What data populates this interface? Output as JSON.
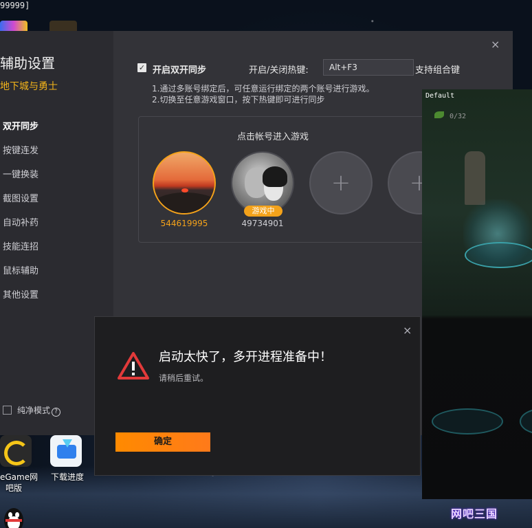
{
  "screen_caption": "99999]",
  "settings": {
    "title": "辅助设置",
    "subtitle": "地下城与勇士",
    "close": "×",
    "nav": [
      {
        "label": "双开同步",
        "active": true
      },
      {
        "label": "按键连发"
      },
      {
        "label": "一键换装"
      },
      {
        "label": "截图设置"
      },
      {
        "label": "自动补药"
      },
      {
        "label": "技能连招"
      },
      {
        "label": "鼠标辅助"
      },
      {
        "label": "其他设置"
      }
    ],
    "pure_mode": {
      "label": "纯净模式",
      "help": "?",
      "checked": false
    },
    "sync": {
      "checked": true,
      "check_mark": "✓",
      "label": "开启双开同步",
      "hotkey_label": "开启/关闭热键:",
      "hotkey_value": "Alt+F3",
      "combo_hint": "支持组合键"
    },
    "notes": [
      "1.通过多账号绑定后，可任意运行绑定的两个账号进行游戏。",
      "2.切换至任意游戏窗口，按下热键即可进行同步"
    ],
    "accounts": {
      "title": "点击帐号进入游戏",
      "items": [
        {
          "id": "544619995",
          "selected": true
        },
        {
          "id": "49734901",
          "badge": "游戏中"
        }
      ],
      "add_symbol": "+"
    }
  },
  "game_window": {
    "title": "Default",
    "counter": "0/32"
  },
  "dialog": {
    "close": "×",
    "title": "启动太快了，多开进程准备中！",
    "message": "请稍后重试。",
    "ok_label": "确定"
  },
  "desktop": {
    "icons": [
      {
        "label_line1": "eGame网",
        "label_line2": "吧版"
      },
      {
        "label": "下载进度"
      }
    ],
    "watermark": "网吧三国"
  },
  "colors": {
    "accent": "#f4a21a",
    "button": "#ff8a00",
    "window_bg": "#333338",
    "sidebar_bg": "#2b2b30",
    "dialog_bg": "#1e1e20"
  }
}
